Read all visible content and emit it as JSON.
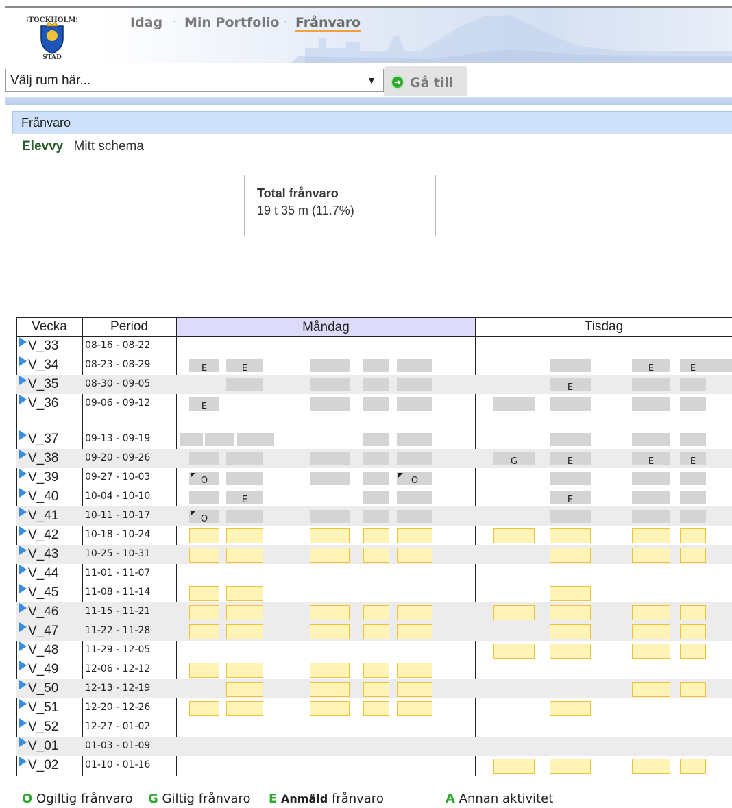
{
  "nav": {
    "items": [
      {
        "label": "Idag",
        "active": false
      },
      {
        "label": "Min Portfolio",
        "active": false
      },
      {
        "label": "Frånvaro",
        "active": true
      }
    ]
  },
  "logo": {
    "icon": "stockholms-stad-crest-icon",
    "lettering": "STOCKHOLMS STAD"
  },
  "room_select": {
    "selected": "Välj rum här..."
  },
  "go_button": {
    "label": "Gå till",
    "icon": "green-arrow-icon"
  },
  "section": {
    "title": "Frånvaro"
  },
  "subnav": {
    "elevvy": "Elevvy",
    "mitt_schema": "Mitt schema"
  },
  "total": {
    "title": "Total frånvaro",
    "value": "19 t 35 m (11.7%)"
  },
  "table": {
    "headers": {
      "vecka": "Vecka",
      "period": "Period",
      "mandag": "Måndag",
      "tisdag": "Tisdag"
    },
    "rows": [
      {
        "week": "V_33",
        "period": "08-16 - 08-22"
      },
      {
        "week": "V_34",
        "period": "08-23 - 08-29"
      },
      {
        "week": "V_35",
        "period": "08-30 - 09-05"
      },
      {
        "week": "V_36",
        "period": "09-06 - 09-12"
      },
      {
        "week": "V_37",
        "period": "09-13 - 09-19"
      },
      {
        "week": "V_38",
        "period": "09-20 - 09-26"
      },
      {
        "week": "V_39",
        "period": "09-27 - 10-03"
      },
      {
        "week": "V_40",
        "period": "10-04 - 10-10"
      },
      {
        "week": "V_41",
        "period": "10-11 - 10-17"
      },
      {
        "week": "V_42",
        "period": "10-18 - 10-24"
      },
      {
        "week": "V_43",
        "period": "10-25 - 10-31"
      },
      {
        "week": "V_44",
        "period": "11-01 - 11-07"
      },
      {
        "week": "V_45",
        "period": "11-08 - 11-14"
      },
      {
        "week": "V_46",
        "period": "11-15 - 11-21"
      },
      {
        "week": "V_47",
        "period": "11-22 - 11-28"
      },
      {
        "week": "V_48",
        "period": "11-29 - 12-05"
      },
      {
        "week": "V_49",
        "period": "12-06 - 12-12"
      },
      {
        "week": "V_50",
        "period": "12-13 - 12-19"
      },
      {
        "week": "V_51",
        "period": "12-20 - 12-26"
      },
      {
        "week": "V_52",
        "period": "12-27 - 01-02"
      },
      {
        "week": "V_01",
        "period": "01-03 - 01-09"
      },
      {
        "week": "V_02",
        "period": "01-10 - 01-16"
      }
    ]
  },
  "legend": {
    "o_key": "O",
    "o_label": "Ogiltig frånvaro",
    "g_key": "G",
    "g_label": "Giltig frånvaro",
    "e_key": "E",
    "e_label_bold": "Anmäld",
    "e_label": "frånvaro",
    "a_key": "A",
    "a_label": "Annan aktivitet"
  },
  "colors": {
    "present": "#d4d4d4",
    "future": "#fff4b6",
    "future_border": "#f0c23a",
    "header_blue": "#cfe0fb",
    "legend_green": "#2ea82e"
  }
}
